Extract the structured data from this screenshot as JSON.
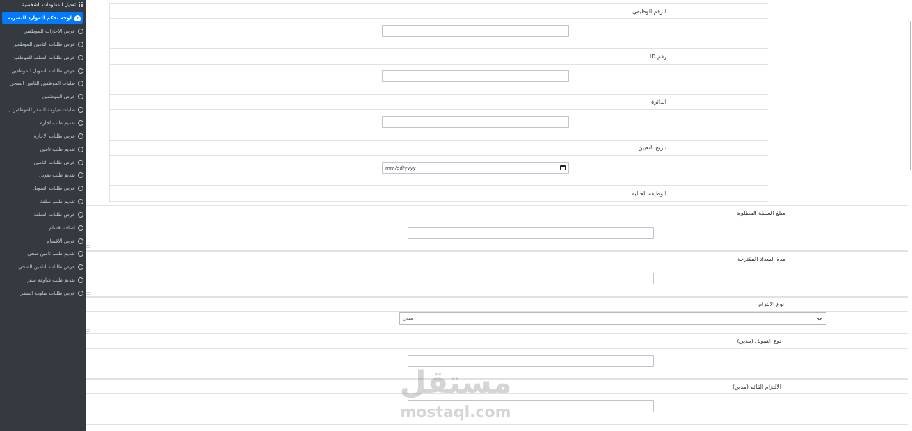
{
  "sidebar": {
    "top_item": {
      "label": "تعديل المعلومات الشخصية",
      "icon": "grid-icon"
    },
    "active_item": {
      "label": "لوحة تحكم للموارد البشرية",
      "icon": "dashboard-gauge-icon"
    },
    "items": [
      {
        "label": "عرض الاجازات للموظفين"
      },
      {
        "label": "عرض طلبات التأمين للموظفين"
      },
      {
        "label": "عرض طلبات السلف للموظفين"
      },
      {
        "label": "عرض طلبات التمويل للموظفين"
      },
      {
        "label": "طلبات الموظفين للتأمين الصحي"
      },
      {
        "label": "عرض الموظفين"
      },
      {
        "label": "طلبات مياومة السفر للموظفين ,"
      },
      {
        "label": "تقديم طلب اجازة"
      },
      {
        "label": "عرض طلبات الاجازة"
      },
      {
        "label": "تقديم طلب تأمين"
      },
      {
        "label": "عرض طلبات التأمين"
      },
      {
        "label": "تقديم طلب تمويل"
      },
      {
        "label": "عرض طلبات التمويل"
      },
      {
        "label": "تقديم طلب سلفة"
      },
      {
        "label": "عرض طلبات السلفة"
      },
      {
        "label": "اضافة اقسام"
      },
      {
        "label": "عرض الأقسام"
      },
      {
        "label": "تقديم طلب تأمين صحي"
      },
      {
        "label": "عرض طلبات التأمين الصحي"
      },
      {
        "label": "تقديم طلب مياومة سفر"
      },
      {
        "label": "عرض طلبات مياومة السفر"
      }
    ],
    "item_icon": "circle-outline-icon",
    "colors": {
      "background": "#343a40",
      "active": "#007bff",
      "text": "#c2c7d0"
    }
  },
  "form_inner": {
    "employee_number": {
      "label": "الرقم الوظيفي",
      "value": ""
    },
    "id_number": {
      "label": "رقم ID",
      "value": ""
    },
    "department": {
      "label": "الدائرة",
      "value": ""
    },
    "hire_date": {
      "label": "تاريخ التعيين",
      "placeholder": "mm/dd/yyyy",
      "value": ""
    },
    "current_job": {
      "label": "الوظيفة الحالية"
    }
  },
  "form_outer": {
    "loan_amount": {
      "label": "مبلغ السلفة المطلوبة",
      "value": ""
    },
    "repayment_period": {
      "label": "مدة السداد المقترحة",
      "value": ""
    },
    "commitment_type": {
      "label": "نوع الالتزام",
      "selected": "مدين"
    },
    "financing_type": {
      "label": "نوع التمويل (مدين)",
      "value": ""
    },
    "existing_commitment": {
      "label": "الالتزام القائم (مدين)",
      "value": ""
    }
  },
  "watermark": {
    "arabic": "مستقل",
    "latin": "mostaql.com"
  }
}
